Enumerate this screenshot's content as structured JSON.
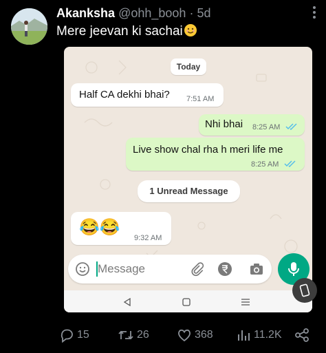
{
  "tweet": {
    "display_name": "Akanksha",
    "handle": "@ohh_booh",
    "time": "5d",
    "text": "Mere jeevan ki sachai"
  },
  "whatsapp": {
    "date_label": "Today",
    "messages": [
      {
        "direction": "incoming",
        "text": "Half CA dekhi bhai?",
        "time": "7:51 AM"
      },
      {
        "direction": "outgoing",
        "text": "Nhi bhai",
        "time": "8:25 AM",
        "status": "read"
      },
      {
        "direction": "outgoing",
        "text": "Live show chal rha h meri life me",
        "time": "8:25 AM",
        "status": "read"
      },
      {
        "direction": "incoming",
        "text": "😂😂",
        "time": "9:32 AM"
      }
    ],
    "unread_label": "1 Unread Message",
    "input_placeholder": "Message",
    "colors": {
      "background": "#efe7de",
      "outgoing": "#dcf8c6",
      "incoming": "#ffffff",
      "accent": "#00a884",
      "read_tick": "#53bdeb"
    }
  },
  "actions": {
    "replies": "15",
    "retweets": "26",
    "likes": "368",
    "views": "11.2K"
  },
  "icons": [
    "more-icon",
    "emoji-icon",
    "attach-icon",
    "rupee-icon",
    "camera-icon",
    "mic-icon",
    "back-nav-icon",
    "home-nav-icon",
    "recents-nav-icon",
    "rotate-icon",
    "reply-icon",
    "retweet-icon",
    "like-icon",
    "views-icon",
    "share-icon"
  ]
}
